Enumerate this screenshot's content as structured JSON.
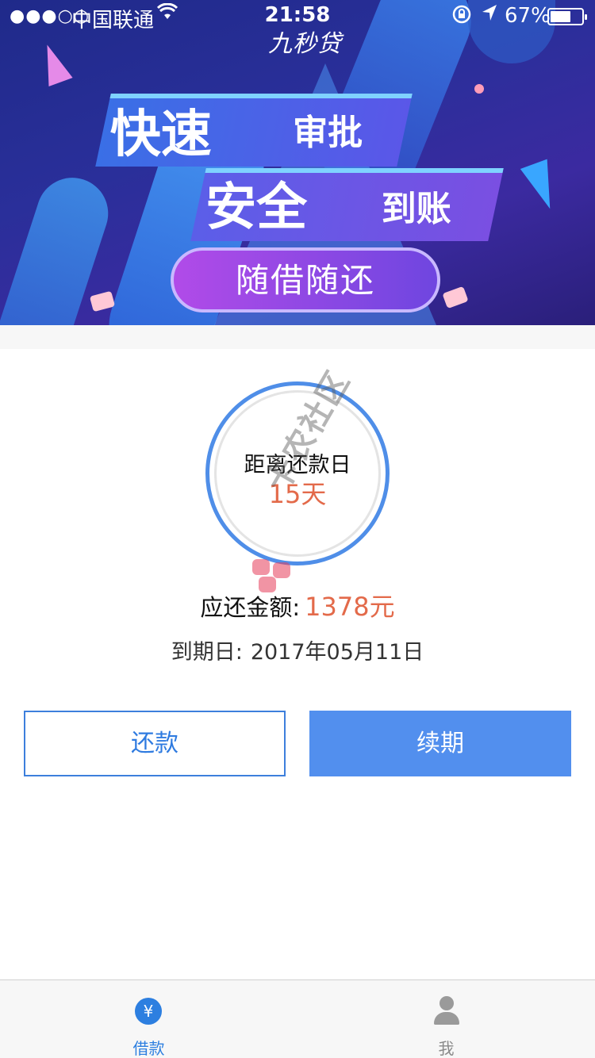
{
  "status_bar": {
    "signal": "●●●○○",
    "carrier": "中国联通",
    "wifi_icon": "wifi-icon",
    "time": "21:58",
    "orientation_lock_icon": "orientation-lock-icon",
    "location_icon": "location-arrow-icon",
    "battery_percent": "67%",
    "battery_level": 0.67
  },
  "banner": {
    "brand": "九秒贷",
    "headline_1_big": "快速",
    "headline_1_small": "审批",
    "headline_2_big": "安全",
    "headline_2_small": "到账",
    "pill_text": "随借随还"
  },
  "countdown": {
    "label": "距离还款日",
    "value": "15天"
  },
  "amount": {
    "label": "应还金额:",
    "value": "1378元"
  },
  "due": {
    "label": "到期日:",
    "date": "2017年05月11日"
  },
  "actions": {
    "repay_label": "还款",
    "renew_label": "续期"
  },
  "watermark": {
    "text": "卡农社区"
  },
  "tabbar": {
    "tabs": [
      {
        "label": "借款",
        "icon": "yen-coin-icon",
        "active": true
      },
      {
        "label": "我",
        "icon": "user-icon",
        "active": false
      }
    ],
    "coin_glyph": "¥"
  },
  "colors": {
    "accent_blue": "#528fee",
    "highlight_orange": "#e36a4a",
    "tab_active": "#2d7fe0",
    "tab_inactive": "#8a8a8a"
  }
}
